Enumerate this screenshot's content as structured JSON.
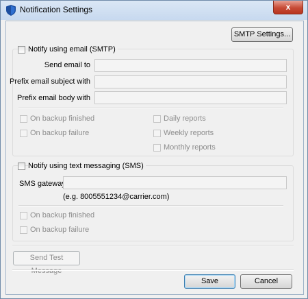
{
  "window": {
    "title": "Notification Settings",
    "close_glyph": "x"
  },
  "smtp_settings_button": "SMTP Settings...",
  "email": {
    "checkbox_label": "Notify using email (SMTP)",
    "send_to_label": "Send email to",
    "subject_prefix_label": "Prefix email subject with",
    "body_prefix_label": "Prefix email body with",
    "send_to_value": "",
    "subject_prefix_value": "",
    "body_prefix_value": "",
    "on_backup_finished": "On backup finished",
    "on_backup_failure": "On backup failure",
    "daily_reports": "Daily reports",
    "weekly_reports": "Weekly reports",
    "monthly_reports": "Monthly reports"
  },
  "sms": {
    "checkbox_label": "Notify using text messaging (SMS)",
    "gateway_label": "SMS gateway",
    "gateway_value": "",
    "example_text": "(e.g. 8005551234@carrier.com)",
    "on_backup_finished": "On backup finished",
    "on_backup_failure": "On backup failure"
  },
  "footer": {
    "send_test_message": "Send Test Message",
    "save": "Save",
    "cancel": "Cancel"
  },
  "colors": {
    "accent": "#3c7fb1",
    "disabled_text": "#8d8d8d",
    "close_button": "#c74b36"
  }
}
